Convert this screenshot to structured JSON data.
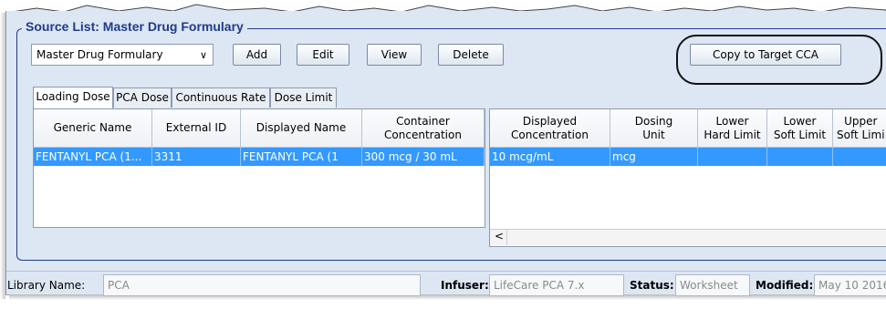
{
  "panel": {
    "title": "Source List: Master Drug Formulary"
  },
  "toolbar": {
    "list_select": "Master Drug Formulary",
    "add_label": "Add",
    "edit_label": "Edit",
    "view_label": "View",
    "delete_label": "Delete",
    "copy_label": "Copy to Target CCA"
  },
  "tabs": [
    "Loading Dose",
    "PCA Dose",
    "Continuous Rate",
    "Dose Limit"
  ],
  "left_table": {
    "columns": [
      "Generic Name",
      "External ID",
      "Displayed Name",
      "Container\nConcentration"
    ],
    "rows": [
      [
        "FENTANYL PCA (1...",
        "3311",
        "FENTANYL PCA (1",
        "300 mcg / 30 mL"
      ]
    ]
  },
  "right_table": {
    "columns": [
      "Displayed\nConcentration",
      "Dosing\nUnit",
      "Lower\nHard Limit",
      "Lower\nSoft Limit",
      "Upper\nSoft Limi"
    ],
    "rows": [
      [
        "10 mcg/mL",
        "mcg",
        "",
        "",
        ""
      ]
    ],
    "scroll_left": "<"
  },
  "status_bar": {
    "library_label": "Library Name:",
    "library_value": "PCA",
    "infuser_label": "Infuser:",
    "infuser_value": "LifeCare PCA 7.x",
    "status_label": "Status:",
    "status_value": "Worksheet",
    "modified_label": "Modified:",
    "modified_value": "May 10 2016"
  },
  "colors": {
    "title_blue": "#1f3c8c",
    "selection": "#3399ff",
    "window_bg": "#dde6f3"
  },
  "icons": {
    "dropdown": "chevron-down-icon",
    "callout": "highlight-ellipse"
  }
}
